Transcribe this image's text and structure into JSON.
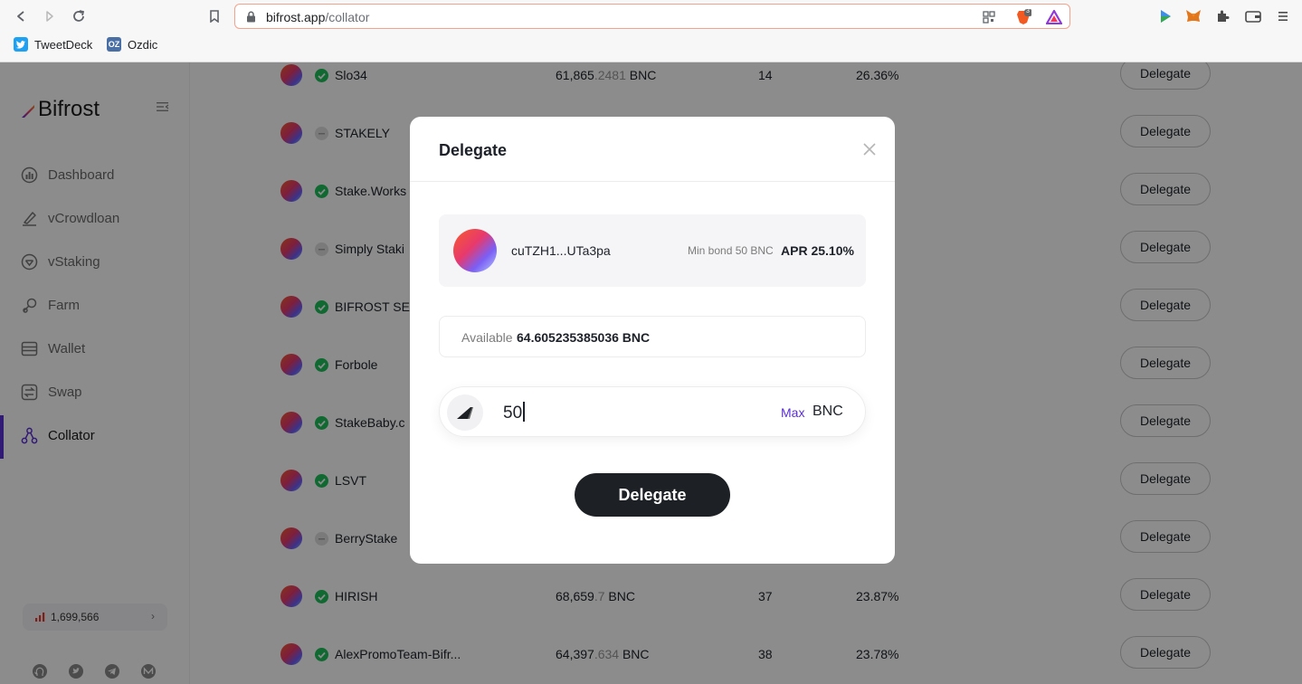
{
  "browser": {
    "url_host": "bifrost.app",
    "url_path": "/collator",
    "brave_badge": "3",
    "bookmarks": [
      {
        "label": "TweetDeck"
      },
      {
        "label": "Ozdic",
        "icon_text": "OZ"
      }
    ]
  },
  "sidebar": {
    "logo_text": "Bifrost",
    "items": [
      {
        "label": "Dashboard",
        "icon": "dashboard-icon"
      },
      {
        "label": "vCrowdloan",
        "icon": "crowdloan-icon"
      },
      {
        "label": "vStaking",
        "icon": "staking-icon"
      },
      {
        "label": "Farm",
        "icon": "farm-icon"
      },
      {
        "label": "Wallet",
        "icon": "wallet-icon"
      },
      {
        "label": "Swap",
        "icon": "swap-icon"
      },
      {
        "label": "Collator",
        "icon": "collator-icon",
        "active": true
      }
    ],
    "block_height": "1,699,566"
  },
  "collators": [
    {
      "name": "Slo34",
      "status": "ok",
      "staked_int": "61,865",
      "staked_dec": ".2481",
      "unit": " BNC",
      "count": "14",
      "apr": "26.36%",
      "button": "Delegate"
    },
    {
      "name": "STAKELY",
      "status": "pending",
      "staked_int": "",
      "staked_dec": "",
      "unit": "",
      "count": "",
      "apr": "%",
      "button": "Delegate"
    },
    {
      "name": "Stake.Works",
      "status": "ok",
      "staked_int": "",
      "staked_dec": "",
      "unit": "",
      "count": "",
      "apr": "%",
      "button": "Delegate"
    },
    {
      "name": "Simply Staki",
      "status": "pending",
      "staked_int": "",
      "staked_dec": "",
      "unit": "",
      "count": "",
      "apr": "%",
      "button": "Delegate"
    },
    {
      "name": "BIFROST SE",
      "status": "ok",
      "staked_int": "",
      "staked_dec": "",
      "unit": "",
      "count": "",
      "apr": "%",
      "button": "Delegate"
    },
    {
      "name": "Forbole",
      "status": "ok",
      "staked_int": "",
      "staked_dec": "",
      "unit": "",
      "count": "",
      "apr": "",
      "button": "Delegate"
    },
    {
      "name": "StakeBaby.c",
      "status": "ok",
      "staked_int": "",
      "staked_dec": "",
      "unit": "",
      "count": "",
      "apr": "%",
      "button": "Delegate"
    },
    {
      "name": "LSVT",
      "status": "ok",
      "staked_int": "",
      "staked_dec": "",
      "unit": "",
      "count": "",
      "apr": "%",
      "button": "Delegate"
    },
    {
      "name": "BerryStake",
      "status": "pending",
      "staked_int": "",
      "staked_dec": "",
      "unit": "",
      "count": "",
      "apr": "%",
      "button": "Delegate"
    },
    {
      "name": "HIRISH",
      "status": "ok",
      "staked_int": "68,659",
      "staked_dec": ".7",
      "unit": " BNC",
      "count": "37",
      "apr": "23.87%",
      "button": "Delegate"
    },
    {
      "name": "AlexPromoTeam-Bifr...",
      "status": "ok",
      "staked_int": "64,397",
      "staked_dec": ".634",
      "unit": " BNC",
      "count": "38",
      "apr": "23.78%",
      "button": "Delegate"
    }
  ],
  "modal": {
    "title": "Delegate",
    "collator_address": "cuTZH1...UTa3pa",
    "min_bond": "Min bond 50 BNC",
    "apr": "APR 25.10%",
    "available_label": "Available",
    "available_value": "64.605235385036 BNC",
    "amount": "50",
    "max_label": "Max",
    "unit": "BNC",
    "submit_label": "Delegate"
  },
  "colors": {
    "accent": "#5a2ed8",
    "status_ok": "#20c05c",
    "button_dark": "#1d2025"
  }
}
